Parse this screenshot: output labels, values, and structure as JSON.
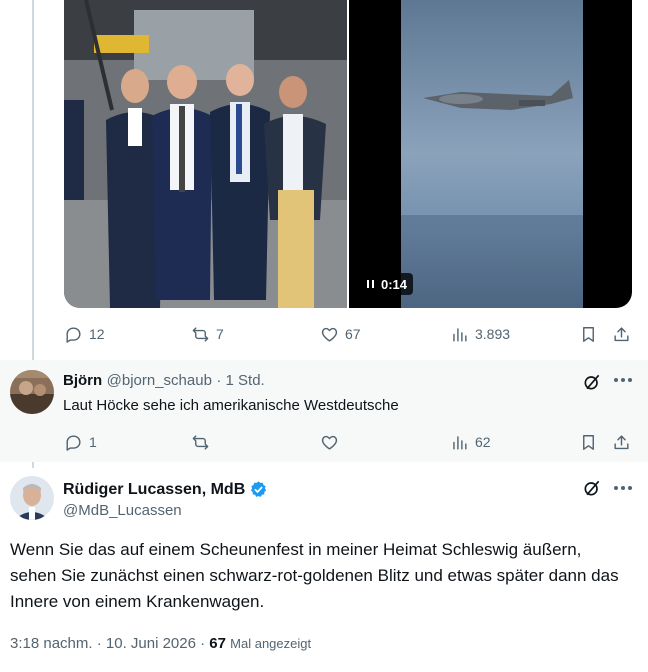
{
  "parent_tweet": {
    "video_duration": "0:14",
    "stats": {
      "replies": "12",
      "reposts": "7",
      "likes": "67",
      "views": "3.893"
    }
  },
  "reply": {
    "author_name": "Björn",
    "author_handle": "@bjorn_schaub",
    "time": "· 1 Std.",
    "text": "Laut Höcke sehe ich amerikanische Westdeutsche",
    "stats": {
      "replies": "1",
      "views": "62"
    }
  },
  "main_tweet": {
    "author_name": "Rüdiger Lucassen, MdB",
    "author_handle": "@MdB_Lucassen",
    "verified_color": "#1d9bf0",
    "text": "Wenn Sie das auf einem Scheunenfest in meiner Heimat Schleswig äußern, sehen Sie zunächst einen schwarz-rot-goldenen Blitz und etwas später dann das Innere von einem Krankenwagen.",
    "time": "3:18 nachm. · 10. Juni 2026 · ",
    "views_count": "67",
    "views_label": "Mal angezeigt"
  },
  "icons": [
    "reply-icon",
    "repost-icon",
    "like-icon",
    "views-icon",
    "bookmark-icon",
    "share-icon",
    "grok-icon",
    "more-icon",
    "verified-badge-icon",
    "pause-icon"
  ]
}
